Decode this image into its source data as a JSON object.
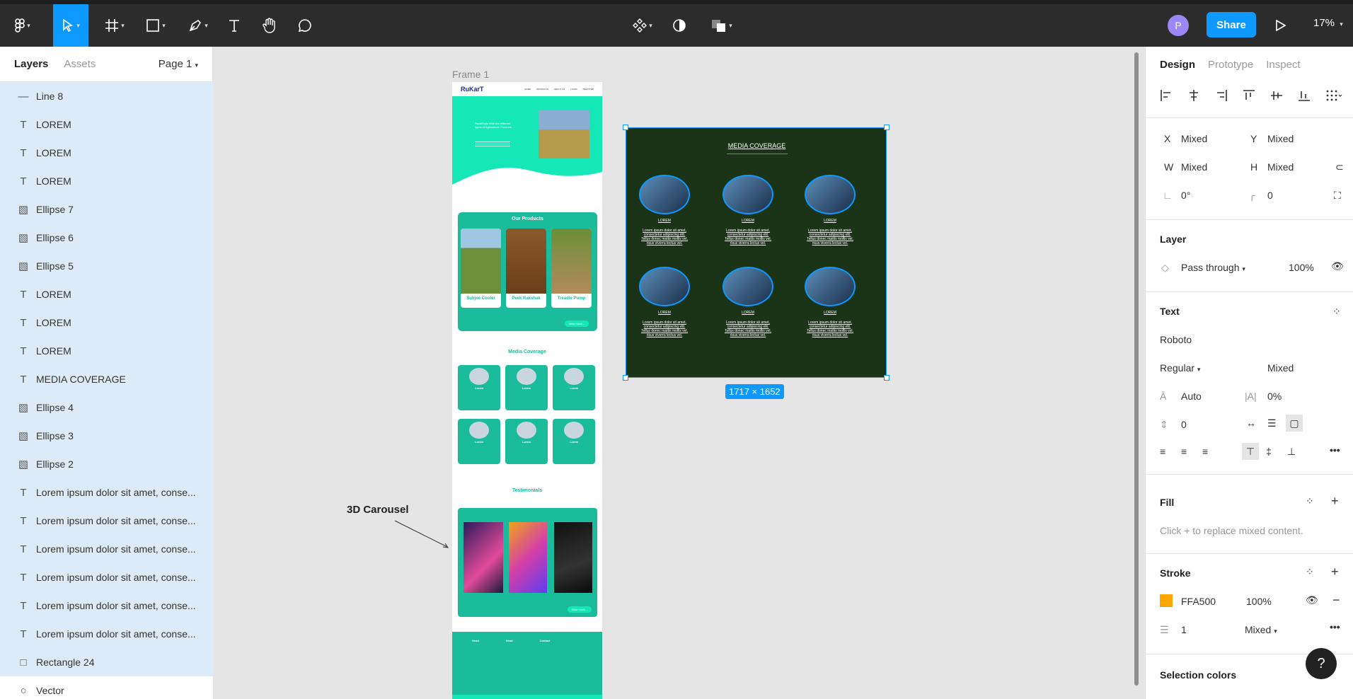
{
  "toolbar": {
    "avatar_letter": "P",
    "share_label": "Share",
    "zoom": "17%"
  },
  "left": {
    "tab_layers": "Layers",
    "tab_assets": "Assets",
    "page": "Page 1",
    "layers": [
      {
        "icon": "line",
        "name": "Line 8"
      },
      {
        "icon": "text",
        "name": "LOREM"
      },
      {
        "icon": "text",
        "name": "LOREM"
      },
      {
        "icon": "text",
        "name": "LOREM"
      },
      {
        "icon": "image",
        "name": "Ellipse 7"
      },
      {
        "icon": "image",
        "name": "Ellipse 6"
      },
      {
        "icon": "image",
        "name": "Ellipse 5"
      },
      {
        "icon": "text",
        "name": "LOREM"
      },
      {
        "icon": "text",
        "name": "LOREM"
      },
      {
        "icon": "text",
        "name": "LOREM"
      },
      {
        "icon": "text",
        "name": "MEDIA COVERAGE"
      },
      {
        "icon": "image",
        "name": "Ellipse 4"
      },
      {
        "icon": "image",
        "name": "Ellipse 3"
      },
      {
        "icon": "image",
        "name": "Ellipse 2"
      },
      {
        "icon": "text",
        "name": "Lorem ipsum dolor sit amet, conse..."
      },
      {
        "icon": "text",
        "name": "Lorem ipsum dolor sit amet, conse..."
      },
      {
        "icon": "text",
        "name": "Lorem ipsum dolor sit amet, conse..."
      },
      {
        "icon": "text",
        "name": "Lorem ipsum dolor sit amet, conse..."
      },
      {
        "icon": "text",
        "name": "Lorem ipsum dolor sit amet, conse..."
      },
      {
        "icon": "text",
        "name": "Lorem ipsum dolor sit amet, conse..."
      },
      {
        "icon": "rect",
        "name": "Rectangle 24"
      },
      {
        "icon": "vector",
        "name": "Vector"
      }
    ]
  },
  "canvas": {
    "frame_label": "Frame 1",
    "carousel_label": "3D Carousel",
    "dimensions": "1717 × 1652",
    "selection": {
      "title": "MEDIA COVERAGE",
      "cell_label": "LOREM",
      "cell_text": "Lorem ipsum dolor sit amet, consectetur adipiscing elit. Tellus donec mattis mollis vel, risus viverra lectus vel."
    },
    "site": {
      "logo": "RuKarT",
      "nav": [
        "HOME",
        "PRODUCTS",
        "ABOUT US",
        "LOGIN",
        "REGISTER"
      ],
      "hero_title": "RuralTools With the different types of Agricultural Products",
      "products_title": "Our Products",
      "products": [
        "Subjee Cooler",
        "Peek Rakshak",
        "Treadle Pump"
      ],
      "view_more": "View more...",
      "media_title": "Media Coverage",
      "media_card": "Lorem",
      "testimonials_title": "Testimonials",
      "footer_heads": [
        "Head",
        "Head",
        "Contact"
      ]
    }
  },
  "right": {
    "tab_design": "Design",
    "tab_prototype": "Prototype",
    "tab_inspect": "Inspect",
    "x_label": "X",
    "x_val": "Mixed",
    "y_label": "Y",
    "y_val": "Mixed",
    "w_label": "W",
    "w_val": "Mixed",
    "h_label": "H",
    "h_val": "Mixed",
    "rotation": "0°",
    "radius": "0",
    "layer_title": "Layer",
    "blend": "Pass through",
    "opacity": "100%",
    "text_title": "Text",
    "font": "Roboto",
    "weight": "Regular",
    "size": "Mixed",
    "line_height": "Auto",
    "letter_spacing": "0%",
    "para_spacing": "0",
    "fill_title": "Fill",
    "fill_hint": "Click + to replace mixed content.",
    "stroke_title": "Stroke",
    "stroke_color": "FFA500",
    "stroke_opacity": "100%",
    "stroke_width": "1",
    "stroke_pos": "Mixed",
    "selection_colors": "Selection colors",
    "stroke_swatch": "#FFA500"
  },
  "help": "?"
}
